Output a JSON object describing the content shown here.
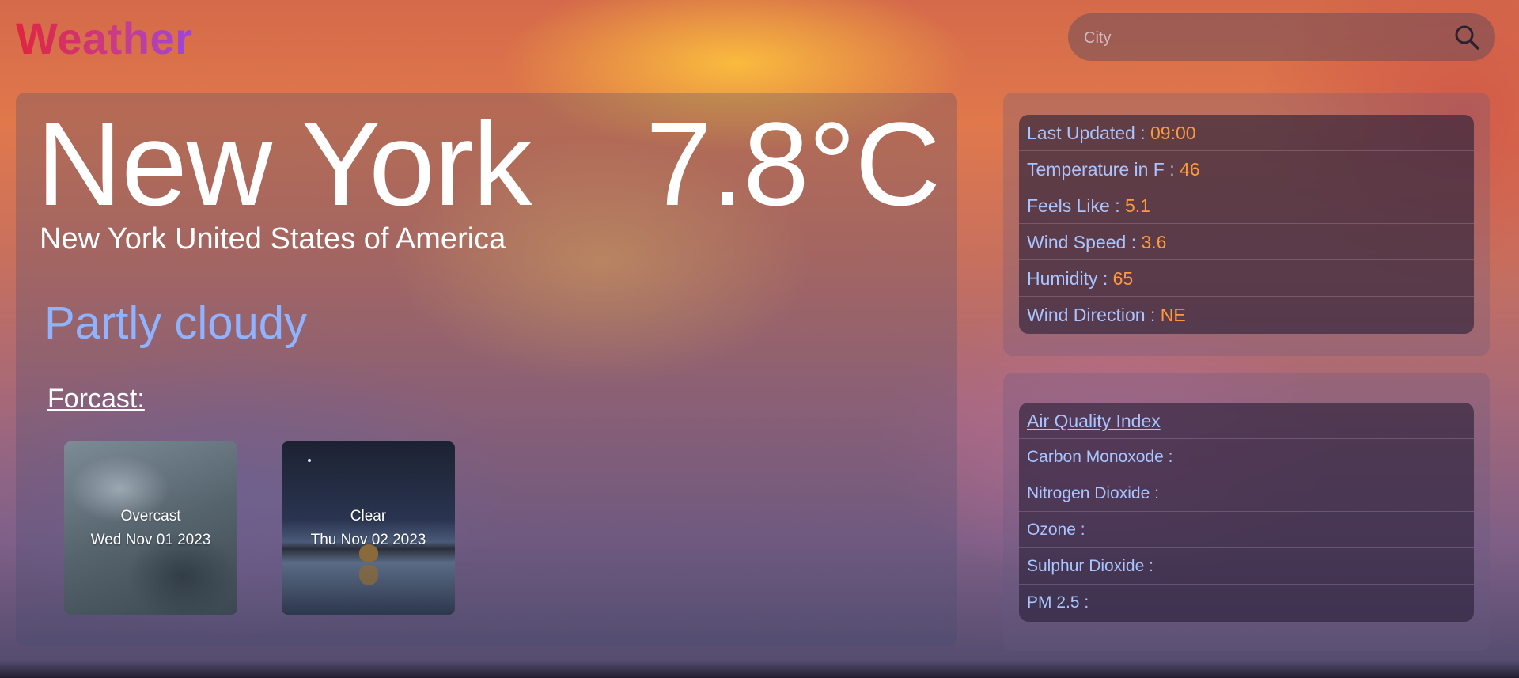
{
  "app": {
    "logo": "Weather"
  },
  "search": {
    "placeholder": "City"
  },
  "current": {
    "city": "New York",
    "temperature": "7.8°C",
    "location": "New York United States of America",
    "condition": "Partly cloudy"
  },
  "forecast": {
    "heading": "Forcast:",
    "days": [
      {
        "condition": "Overcast",
        "date": "Wed Nov 01 2023"
      },
      {
        "condition": "Clear",
        "date": "Thu Nov 02 2023"
      }
    ]
  },
  "details": {
    "rows": [
      {
        "label": "Last Updated : ",
        "value": "09:00"
      },
      {
        "label": "Temperature in F : ",
        "value": "46"
      },
      {
        "label": "Feels Like : ",
        "value": "5.1"
      },
      {
        "label": "Wind Speed : ",
        "value": "3.6"
      },
      {
        "label": "Humidity : ",
        "value": "65"
      },
      {
        "label": "Wind Direction : ",
        "value": "NE"
      }
    ]
  },
  "air_quality": {
    "title": "Air Quality Index",
    "rows": [
      {
        "label": "Carbon Monoxode :"
      },
      {
        "label": "Nitrogen Dioxide :"
      },
      {
        "label": "Ozone :"
      },
      {
        "label": "Sulphur Dioxide :"
      },
      {
        "label": "PM 2.5 :"
      }
    ]
  },
  "colors": {
    "accent_value": "#ff9a3c",
    "label_blue": "#a9c4ff",
    "condition_blue": "#8fb3ff"
  },
  "icons": {
    "search": "search-icon"
  }
}
